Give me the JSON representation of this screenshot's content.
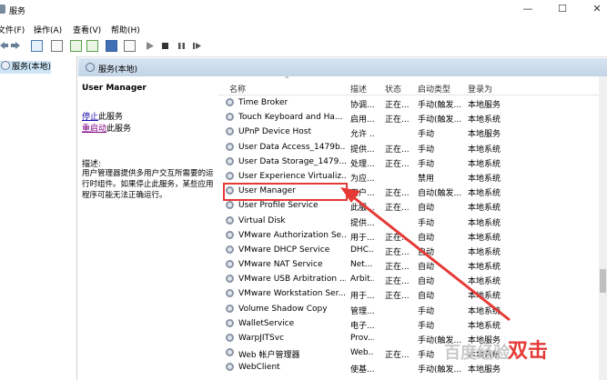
{
  "window": {
    "title": "服务"
  },
  "menu": [
    "文件(F)",
    "操作(A)",
    "查看(V)",
    "帮助(H)"
  ],
  "tree": {
    "selected": "服务(本地)"
  },
  "header": {
    "title": "服务(本地)"
  },
  "detail": {
    "service_name": "User Manager",
    "stop_link": "停止",
    "stop_suffix": "此服务",
    "restart_link": "重启动",
    "restart_suffix": "此服务",
    "desc_label": "描述:",
    "description": "用户管理器提供多用户交互所需要的运行时组件。如果停止此服务，某些应用程序可能无法正确运行。"
  },
  "columns": [
    "名称",
    "描述",
    "状态",
    "启动类型",
    "登录为"
  ],
  "rows": [
    {
      "name": "Time Broker",
      "desc": "协调...",
      "status": "正在...",
      "type": "手动(触发...",
      "logon": "本地服务"
    },
    {
      "name": "Touch Keyboard and Ha...",
      "desc": "启用...",
      "status": "正在...",
      "type": "手动(触发...",
      "logon": "本地系统"
    },
    {
      "name": "UPnP Device Host",
      "desc": "允许 ...",
      "status": "",
      "type": "手动",
      "logon": "本地服务"
    },
    {
      "name": "User Data Access_1479b...",
      "desc": "提供...",
      "status": "正在...",
      "type": "手动",
      "logon": "本地系统"
    },
    {
      "name": "User Data Storage_1479...",
      "desc": "处理...",
      "status": "正在...",
      "type": "手动",
      "logon": "本地系统"
    },
    {
      "name": "User Experience Virtualiz...",
      "desc": "为应...",
      "status": "",
      "type": "禁用",
      "logon": "本地系统"
    },
    {
      "name": "User Manager",
      "desc": "用户...",
      "status": "正在...",
      "type": "自动(触发...",
      "logon": "本地系统"
    },
    {
      "name": "User Profile Service",
      "desc": "此服...",
      "status": "正在...",
      "type": "自动",
      "logon": "本地系统"
    },
    {
      "name": "Virtual Disk",
      "desc": "提供...",
      "status": "",
      "type": "手动",
      "logon": "本地系统"
    },
    {
      "name": "VMware Authorization Se...",
      "desc": "用于...",
      "status": "正在...",
      "type": "自动",
      "logon": "本地系统"
    },
    {
      "name": "VMware DHCP Service",
      "desc": "DHC...",
      "status": "正在...",
      "type": "自动",
      "logon": "本地系统"
    },
    {
      "name": "VMware NAT Service",
      "desc": "Net...",
      "status": "正在...",
      "type": "自动",
      "logon": "本地系统"
    },
    {
      "name": "VMware USB Arbitration ...",
      "desc": "Arbit...",
      "status": "正在...",
      "type": "自动",
      "logon": "本地系统"
    },
    {
      "name": "VMware Workstation Ser...",
      "desc": "用于...",
      "status": "正在...",
      "type": "自动",
      "logon": "本地系统"
    },
    {
      "name": "Volume Shadow Copy",
      "desc": "管理...",
      "status": "",
      "type": "手动",
      "logon": "本地系统"
    },
    {
      "name": "WalletService",
      "desc": "电子...",
      "status": "",
      "type": "手动",
      "logon": "本地系统"
    },
    {
      "name": "WarpJITSvc",
      "desc": "Prov...",
      "status": "",
      "type": "手动(触发...",
      "logon": "本地服务"
    },
    {
      "name": "Web 帐户管理器",
      "desc": "Web...",
      "status": "正在...",
      "type": "手动",
      "logon": "本地系统"
    },
    {
      "name": "WebClient",
      "desc": "使基...",
      "status": "",
      "type": "手动(触发...",
      "logon": "本地服务"
    }
  ],
  "annotation": {
    "text": "双击",
    "color": "#e53935"
  },
  "watermark": {
    "text": "百度经验"
  }
}
